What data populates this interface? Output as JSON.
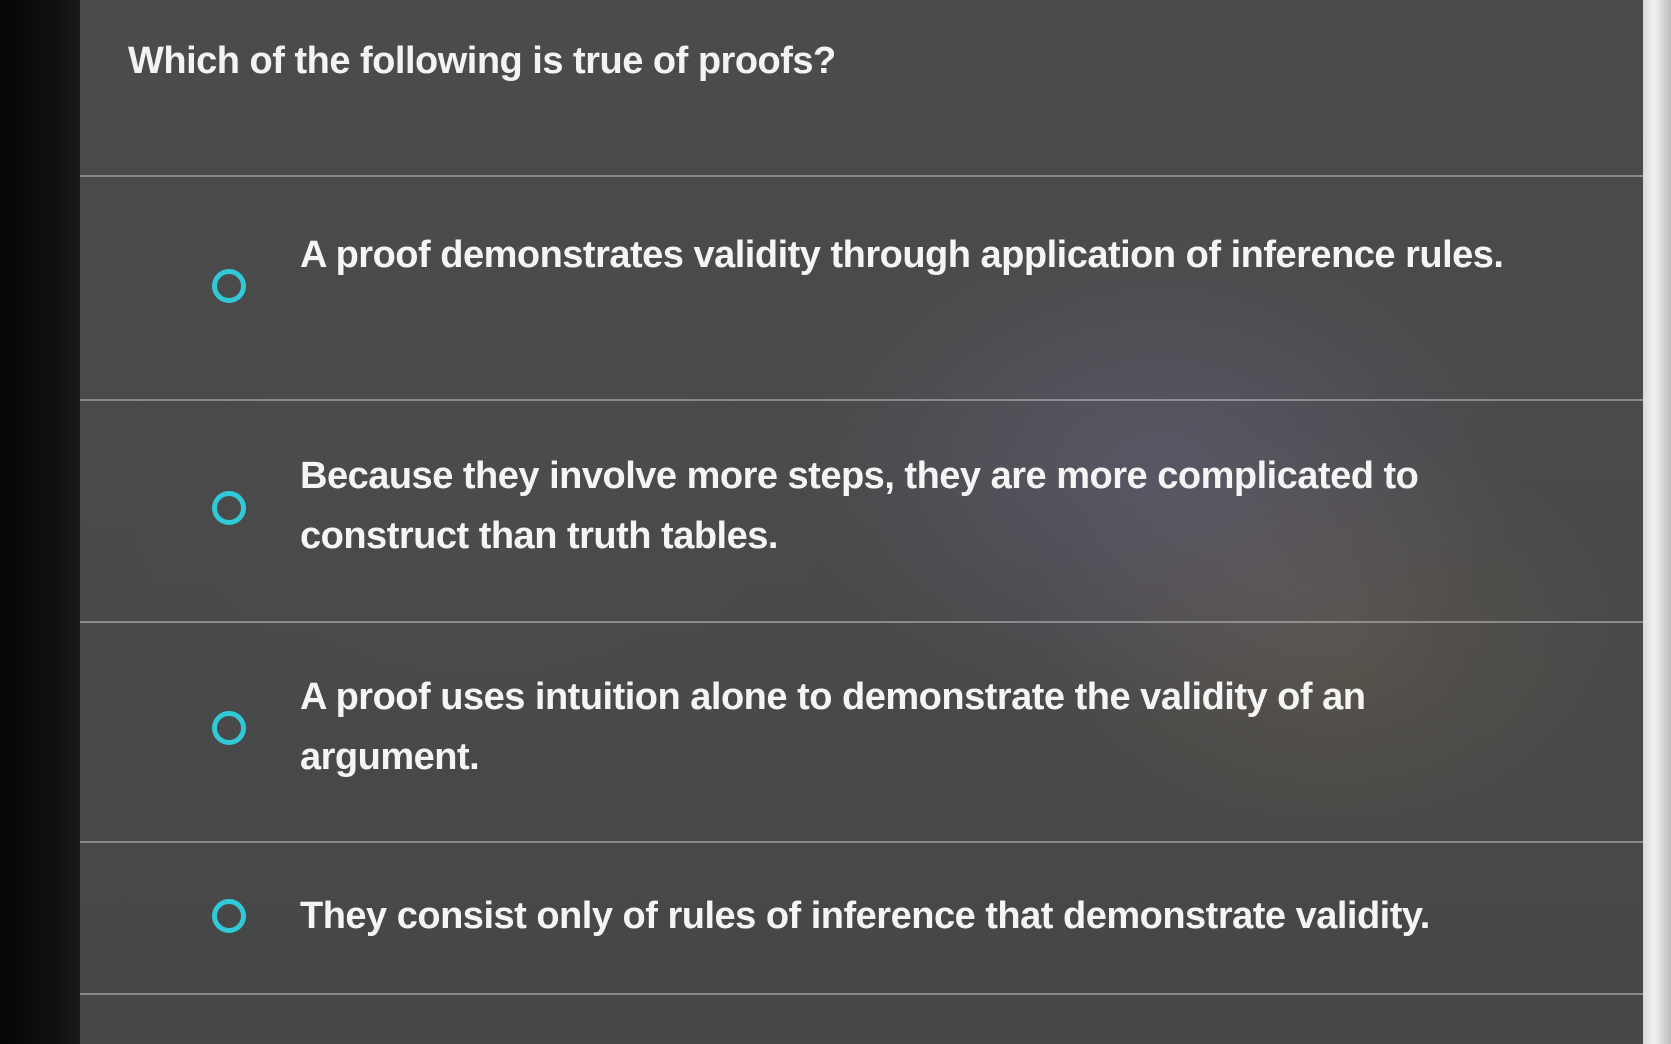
{
  "quiz": {
    "question": "Which of the following is true of proofs?",
    "options": [
      {
        "label": "A proof demonstrates validity through application of inference rules."
      },
      {
        "label": "Because they involve more steps, they are more complicated to construct than truth tables."
      },
      {
        "label": "A proof uses intuition alone to demonstrate the validity of an argument."
      },
      {
        "label": "They consist only of rules of inference that demonstrate validity."
      }
    ]
  },
  "colors": {
    "radio_accent": "#31c9d8",
    "background": "#4a4a49",
    "text": "#f5f5f5"
  }
}
